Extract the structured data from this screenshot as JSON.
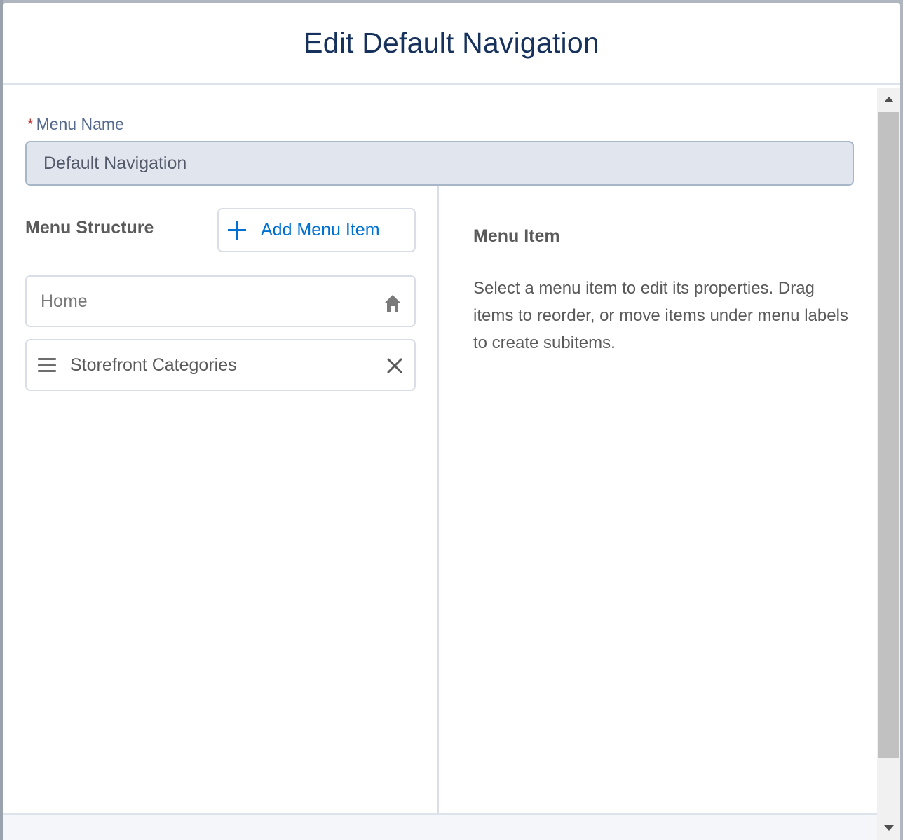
{
  "modal": {
    "title": "Edit Default Navigation"
  },
  "menu_name": {
    "label": "Menu Name",
    "required_marker": "*",
    "value": "Default Navigation"
  },
  "menu_structure": {
    "heading": "Menu Structure",
    "add_button_label": "Add Menu Item",
    "items": [
      {
        "label": "Home",
        "icon": "home-icon"
      },
      {
        "label": "Storefront Categories",
        "icon": "drag-handle-icon",
        "action_icon": "close-icon"
      }
    ]
  },
  "menu_item_panel": {
    "heading": "Menu Item",
    "help_text": "Select a menu item to edit its properties. Drag items to reorder, or move items under menu labels to create subitems."
  },
  "colors": {
    "title": "#16325c",
    "accent": "#0070d2",
    "required": "#c23934",
    "input_bg": "#e0e5ee"
  }
}
